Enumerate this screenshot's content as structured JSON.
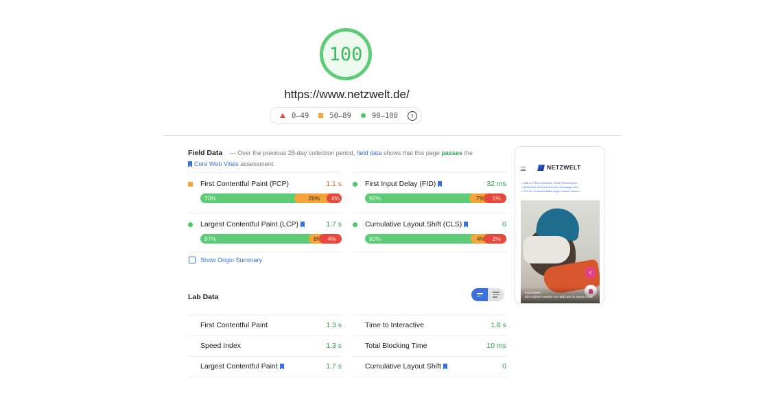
{
  "score": {
    "value": "100",
    "color": "#3fb95c"
  },
  "url": "https://www.netzwelt.de/",
  "legend": {
    "ranges": [
      {
        "icon": "triangle-icon",
        "label": "0–49",
        "color": "#e8483c"
      },
      {
        "icon": "square-icon",
        "label": "50–89",
        "color": "#f5a43a"
      },
      {
        "icon": "circle-icon",
        "label": "90–100",
        "color": "#4fc468"
      }
    ],
    "info_icon": "info-icon"
  },
  "field_data": {
    "title": "Field Data",
    "desc_prefix": "— Over the previous 28-day collection period,",
    "desc_link": "field data",
    "desc_mid": "shows that this page",
    "desc_status": "passes",
    "desc_mid2": "the",
    "cwv_link": "Core Web Vitals",
    "desc_suffix": "assessment.",
    "metrics": [
      {
        "name": "First Contentful Paint (FCP)",
        "value": "1.1 s",
        "status": "average",
        "bookmark": false,
        "distribution": {
          "good": "70%",
          "needs_improvement": "26%",
          "poor": "4%"
        }
      },
      {
        "name": "First Input Delay (FID)",
        "value": "32 ms",
        "status": "pass",
        "bookmark": true,
        "distribution": {
          "good": "92%",
          "needs_improvement": "7%",
          "poor": "1%"
        }
      },
      {
        "name": "Largest Contentful Paint (LCP)",
        "value": "1.7 s",
        "status": "pass",
        "bookmark": true,
        "distribution": {
          "good": "87%",
          "needs_improvement": "8%",
          "poor": "4%"
        }
      },
      {
        "name": "Cumulative Layout Shift (CLS)",
        "value": "0",
        "status": "pass",
        "bookmark": true,
        "distribution": {
          "good": "93%",
          "needs_improvement": "4%",
          "poor": "2%"
        }
      }
    ],
    "origin_summary_label": "Show Origin Summary"
  },
  "lab_data": {
    "title": "Lab Data",
    "view_toggle": {
      "active": "bar-view",
      "inactive": "list-view"
    },
    "metrics": [
      {
        "name": "First Contentful Paint",
        "value": "1.3 s",
        "bookmark": false
      },
      {
        "name": "Time to Interactive",
        "value": "1.8 s",
        "bookmark": false
      },
      {
        "name": "Speed Index",
        "value": "1.3 s",
        "bookmark": false
      },
      {
        "name": "Total Blocking Time",
        "value": "10 ms",
        "bookmark": false
      },
      {
        "name": "Largest Contentful Paint",
        "value": "1.7 s",
        "bookmark": true
      },
      {
        "name": "Cumulative Layout Shift",
        "value": "0",
        "bookmark": true
      }
    ]
  },
  "screenshot": {
    "logo": "NETZWELT",
    "news": [
      "Statt 4,19 Euro kostenlos: Diese Premium-App ...",
      "Weltrekord mit 3.281 Drohnen: So erzeugt man ...",
      "PS5 Pro: Exklusive Bilder zeigen unsere Vision z..."
    ],
    "caption_kicker": "Kuriositäten",
    "caption_title": "Die Hightech-Maske von Will.i.am im Space-Look"
  },
  "colors": {
    "good": "#5ecc77",
    "average": "#f5a43a",
    "poor": "#e8483c",
    "link": "#3a6fe0"
  }
}
